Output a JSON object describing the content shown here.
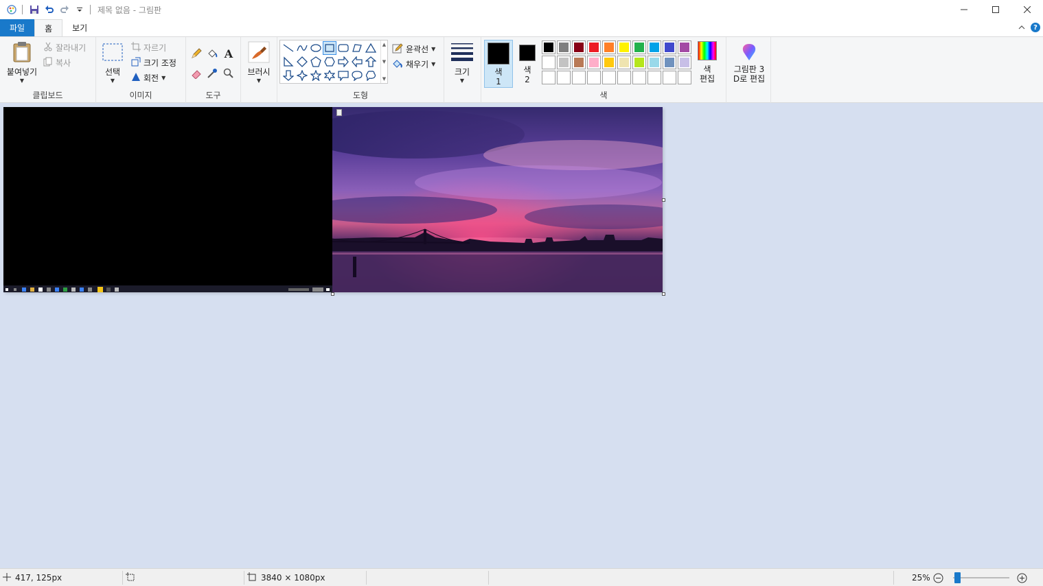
{
  "window": {
    "title": "제목 없음 - 그림판"
  },
  "tabs": {
    "file": "파일",
    "home": "홈",
    "view": "보기"
  },
  "clipboard": {
    "paste": "붙여넣기",
    "cut": "잘라내기",
    "copy": "복사",
    "label": "클립보드"
  },
  "image": {
    "select": "선택",
    "crop": "자르기",
    "resize": "크기 조정",
    "rotate": "회전",
    "label": "이미지"
  },
  "tools": {
    "label": "도구"
  },
  "brushes": {
    "label": "브러시"
  },
  "shapes": {
    "outline": "윤곽선",
    "fill": "채우기",
    "label": "도형"
  },
  "size": {
    "label": "크기"
  },
  "colors": {
    "color1_line1": "색",
    "color1_line2": "1",
    "color2_line1": "색",
    "color2_line2": "2",
    "edit_line1": "색",
    "edit_line2": "편집",
    "label": "색",
    "color1": "#000000",
    "color2": "#000000",
    "palette_row1": [
      "#000000",
      "#7f7f7f",
      "#880015",
      "#ed1c24",
      "#ff7f27",
      "#fff200",
      "#22b14c",
      "#00a2e8",
      "#3f48cc",
      "#a349a4"
    ],
    "palette_row2": [
      "#ffffff",
      "#c3c3c3",
      "#b97a57",
      "#ffaec9",
      "#ffc90e",
      "#efe4b0",
      "#b5e61d",
      "#99d9ea",
      "#7092be",
      "#c8bfe7"
    ]
  },
  "paint3d": {
    "line1": "그림판 3",
    "line2": "D로 편집"
  },
  "status": {
    "cursor": "417, 125px",
    "image_size": "3840 × 1080px",
    "zoom": "25%"
  }
}
